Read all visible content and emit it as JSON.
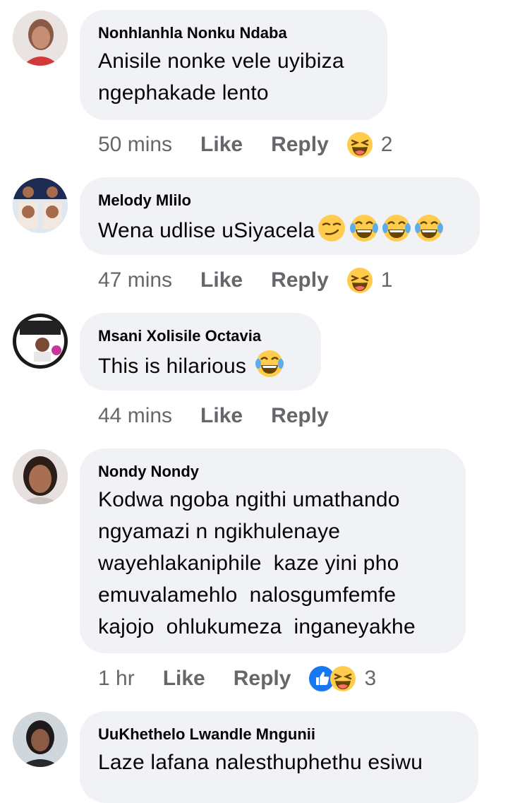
{
  "comments": [
    {
      "author": "Nonhlanhla Nonku Ndaba",
      "text": "Anisile nonke vele uyibiza\nngephakade lento",
      "time": "50 mins",
      "like": "Like",
      "reply": "Reply",
      "reaction_count": "2",
      "reactions": [
        "laughing-squint-icon"
      ]
    },
    {
      "author": "Melody Mlilo",
      "text": "Wena udlise uSiyacela",
      "inline_emojis": [
        "smirk-icon",
        "tears-of-joy-icon",
        "tears-of-joy-icon",
        "tears-of-joy-icon"
      ],
      "time": "47 mins",
      "like": "Like",
      "reply": "Reply",
      "reaction_count": "1",
      "reactions": [
        "laughing-squint-icon"
      ]
    },
    {
      "author": "Msani Xolisile Octavia",
      "text": "This is hilarious ",
      "inline_emojis": [
        "tears-of-joy-icon"
      ],
      "time": "44 mins",
      "like": "Like",
      "reply": "Reply"
    },
    {
      "author": "Nondy Nondy",
      "text": "Kodwa ngoba ngithi umathando\nngyamazi n ngikhulenaye\nwayehlakaniphile  kaze yini pho\nemuvalamehlo  nalosgumfemfe\nkajojo  ohlukumeza  inganeyakhe",
      "time": "1 hr",
      "like": "Like",
      "reply": "Reply",
      "reaction_count": "3",
      "reactions": [
        "like-icon",
        "laughing-squint-icon"
      ]
    },
    {
      "author": "UuKhethelo Lwandle Mngunii",
      "text": "Laze lafana nalesthuphethu esiwu"
    }
  ],
  "colors": {
    "bubble": "#f0f2f5",
    "meta_text": "#65676b",
    "like_blue": "#1877f2",
    "emoji_yellow": "#ffcc4d"
  }
}
